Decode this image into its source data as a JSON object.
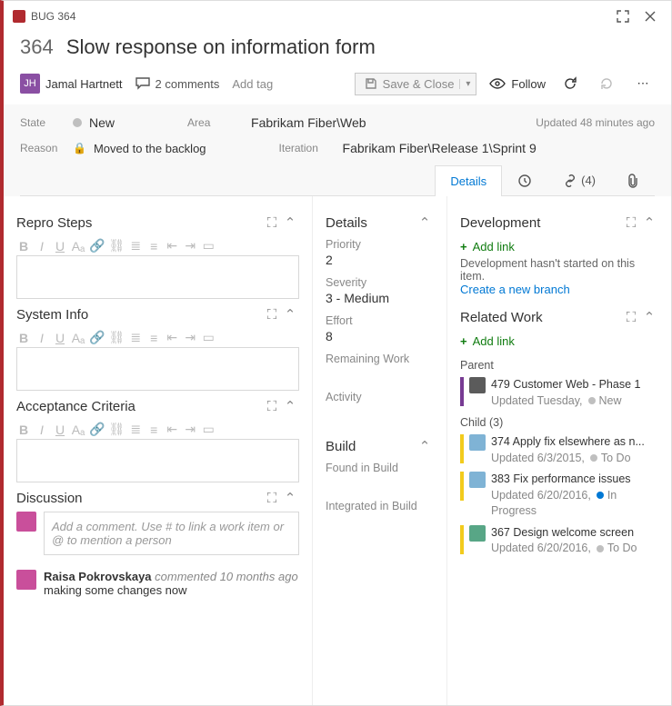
{
  "window": {
    "type": "BUG",
    "id": "364"
  },
  "title": {
    "id": "364",
    "text": "Slow response on information form"
  },
  "assignee": "Jamal Hartnett",
  "comments_label": "2 comments",
  "add_tag": "Add tag",
  "save_close": "Save & Close",
  "follow": "Follow",
  "state": {
    "label": "State",
    "value": "New"
  },
  "reason": {
    "label": "Reason",
    "value": "Moved to the backlog"
  },
  "area": {
    "label": "Area",
    "value": "Fabrikam Fiber\\Web"
  },
  "iteration": {
    "label": "Iteration",
    "value": "Fabrikam Fiber\\Release 1\\Sprint 9"
  },
  "updated": "Updated 48 minutes ago",
  "tabs": {
    "details": "Details",
    "links": "(4)"
  },
  "left": {
    "repro": "Repro Steps",
    "sysinfo": "System Info",
    "acc": "Acceptance Criteria",
    "discussion": "Discussion",
    "comment_placeholder": "Add a comment. Use # to link a work item or @ to mention a person",
    "disc_name": "Raisa Pokrovskaya",
    "disc_meta": "commented 10 months ago",
    "disc_text": "making some changes now"
  },
  "mid": {
    "details": "Details",
    "priority_l": "Priority",
    "priority_v": "2",
    "severity_l": "Severity",
    "severity_v": "3 - Medium",
    "effort_l": "Effort",
    "effort_v": "8",
    "remaining_l": "Remaining Work",
    "activity_l": "Activity",
    "build": "Build",
    "found_l": "Found in Build",
    "integrated_l": "Integrated in Build"
  },
  "right": {
    "dev": "Development",
    "addlink": "Add link",
    "dev_msg": "Development hasn't started on this item.",
    "create_branch": "Create a new branch",
    "related": "Related Work",
    "parent": "Parent",
    "child": "Child (3)",
    "p1_id": "479",
    "p1_t": "Customer Web - Phase 1",
    "p1_u": "Updated Tuesday,",
    "p1_s": "New",
    "c1_id": "374",
    "c1_t": "Apply fix elsewhere as n...",
    "c1_u": "Updated 6/3/2015,",
    "c1_s": "To Do",
    "c2_id": "383",
    "c2_t": "Fix performance issues",
    "c2_u": "Updated 6/20/2016,",
    "c2_s": "In Progress",
    "c3_id": "367",
    "c3_t": "Design welcome screen",
    "c3_u": "Updated 6/20/2016,",
    "c3_s": "To Do"
  }
}
